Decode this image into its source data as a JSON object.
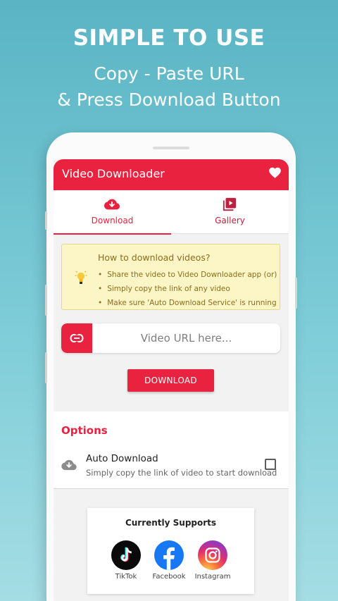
{
  "promo": {
    "title": "SIMPLE TO USE",
    "line1": "Copy - Paste URL",
    "line2": "& Press Download Button"
  },
  "app": {
    "title": "Video Downloader",
    "accent_color": "#e8223f",
    "favorite_icon": "heart-icon"
  },
  "tabs": [
    {
      "label": "Download",
      "icon": "cloud-download-icon",
      "active": true
    },
    {
      "label": "Gallery",
      "icon": "video-library-icon",
      "active": false
    }
  ],
  "howto": {
    "title": "How to download videos?",
    "icon": "lightbulb-icon",
    "steps": [
      "Share the video to Video Downloader app (or)",
      "Simply copy the link of any video",
      "Make sure 'Auto Download Service' is running"
    ]
  },
  "url_input": {
    "icon": "link-icon",
    "placeholder": "Video URL here...",
    "value": ""
  },
  "download_button": {
    "label": "DOWNLOAD"
  },
  "options": {
    "title": "Options",
    "auto_download": {
      "icon": "cloud-download-icon",
      "name": "Auto Download",
      "description": "Simply copy the link of video to start download",
      "checked": false
    }
  },
  "supports": {
    "title": "Currently Supports",
    "platforms": [
      {
        "name": "TikTok",
        "icon": "tiktok-icon"
      },
      {
        "name": "Facebook",
        "icon": "facebook-icon"
      },
      {
        "name": "Instagram",
        "icon": "instagram-icon"
      }
    ]
  }
}
